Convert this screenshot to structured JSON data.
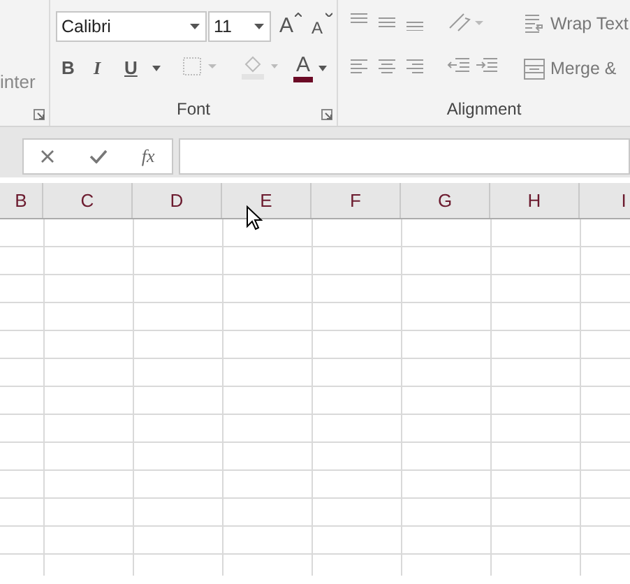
{
  "ribbon": {
    "clipped_label": "inter",
    "font_group": {
      "font_name": "Calibri",
      "font_size": "11",
      "grow_font": "A",
      "shrink_font": "A",
      "font_color": "A",
      "bold": "B",
      "italic": "I",
      "underline": "U",
      "label": "Font"
    },
    "alignment_group": {
      "wrap_text": "Wrap Text",
      "merge": "Merge &",
      "label": "Alignment"
    }
  },
  "formula_bar": {
    "function_label": "fx"
  },
  "column_headers": [
    "B",
    "C",
    "D",
    "E",
    "F",
    "G",
    "H",
    "I"
  ]
}
